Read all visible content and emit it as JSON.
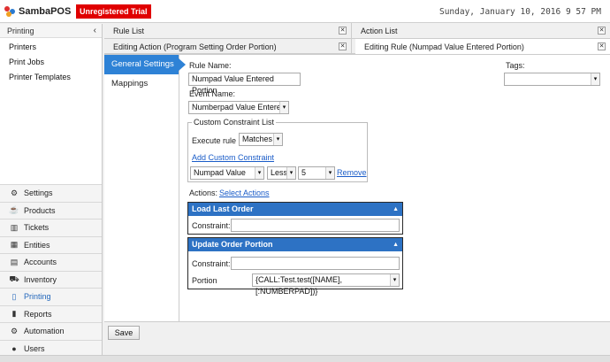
{
  "app": {
    "logo_text": "SambaPOS",
    "trial_badge": "Unregistered Trial",
    "datetime": "Sunday, January 10, 2016 9 57 PM"
  },
  "sidebar": {
    "header": "Printing",
    "items": [
      {
        "label": "Printers"
      },
      {
        "label": "Print Jobs"
      },
      {
        "label": "Printer Templates"
      }
    ],
    "nav": [
      {
        "label": "Settings",
        "icon": "gear-icon"
      },
      {
        "label": "Products",
        "icon": "coffee-cup-icon"
      },
      {
        "label": "Tickets",
        "icon": "tickets-icon"
      },
      {
        "label": "Entities",
        "icon": "table-icon"
      },
      {
        "label": "Accounts",
        "icon": "calculator-icon"
      },
      {
        "label": "Inventory",
        "icon": "truck-icon"
      },
      {
        "label": "Printing",
        "icon": "document-icon",
        "active": true
      },
      {
        "label": "Reports",
        "icon": "bar-chart-icon"
      },
      {
        "label": "Automation",
        "icon": "gears-icon"
      },
      {
        "label": "Users",
        "icon": "user-icon"
      }
    ]
  },
  "tabs": {
    "top": [
      {
        "label": "Rule List"
      },
      {
        "label": "Action List"
      }
    ],
    "second": [
      {
        "label": "Editing Action (Program Setting Order Portion)"
      },
      {
        "label": "Editing Rule (Numpad Value Entered Portion)",
        "active": true
      }
    ]
  },
  "subnav": [
    {
      "label": "General Settings",
      "active": true
    },
    {
      "label": "Mappings"
    }
  ],
  "form": {
    "rule_name_label": "Rule Name:",
    "rule_name_value": "Numpad Value Entered Portion",
    "event_name_label": "Event Name:",
    "event_name_value": "Numberpad Value Entered",
    "tags_label": "Tags:",
    "tags_value": "",
    "custom_constraint_title": "Custom Constraint List",
    "execute_label": "Execute rule if",
    "execute_value": "Matches",
    "add_constraint_link": "Add Custom Constraint",
    "constraint_row": {
      "field": "Numpad Value",
      "operator": "Less",
      "value": "5",
      "remove": "Remove"
    },
    "actions_label": "Actions:",
    "select_actions_link": "Select Actions"
  },
  "actions": [
    {
      "title": "Load Last Order",
      "constraint_label": "Constraint:",
      "constraint_value": ""
    },
    {
      "title": "Update Order Portion",
      "constraint_label": "Constraint:",
      "constraint_value": "",
      "portion_label": "Portion",
      "portion_value": "{CALL:Test.test([NAME],[:NUMBERPAD])}"
    }
  ],
  "footer": {
    "save_label": "Save"
  }
}
